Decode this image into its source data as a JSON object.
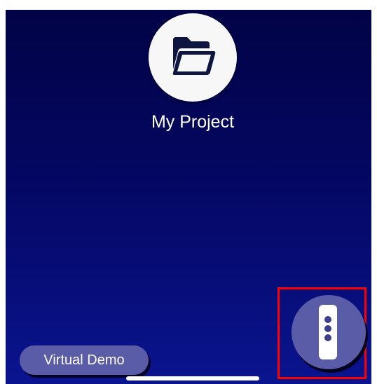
{
  "project": {
    "name": "My Project",
    "icon": "folder-icon"
  },
  "demo_button": {
    "label": "Virtual Demo"
  },
  "remote_button": {
    "icon": "remote-control-icon",
    "highlighted": true,
    "highlight_color": "#ff0000"
  },
  "colors": {
    "background_top": "#020346",
    "background_bottom": "#0a148f",
    "button_fill": "#5a5ca8",
    "folder_circle": "#f7f7f7",
    "folder_icon": "#0d1540"
  }
}
